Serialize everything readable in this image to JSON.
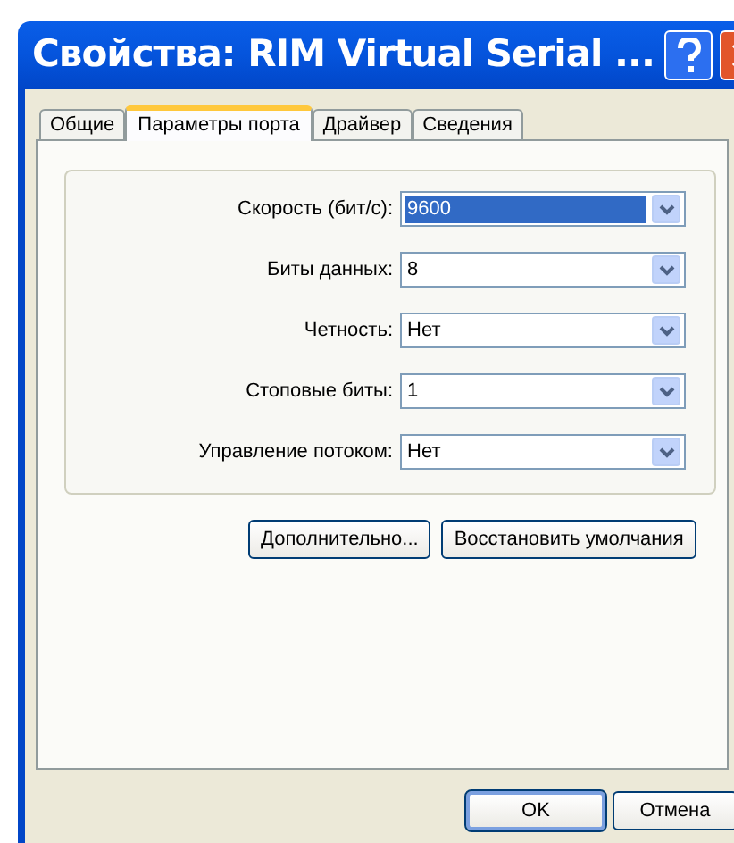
{
  "window": {
    "title": "Свойства: RIM Virtual Serial ..."
  },
  "tabs": [
    {
      "label": "Общие",
      "selected": false
    },
    {
      "label": "Параметры порта",
      "selected": true
    },
    {
      "label": "Драйвер",
      "selected": false
    },
    {
      "label": "Сведения",
      "selected": false
    }
  ],
  "settings": [
    {
      "label": "Скорость (бит/с):",
      "value": "9600",
      "focused": true
    },
    {
      "label": "Биты данных:",
      "value": "8",
      "focused": false
    },
    {
      "label": "Четность:",
      "value": "Нет",
      "focused": false
    },
    {
      "label": "Стоповые биты:",
      "value": "1",
      "focused": false
    },
    {
      "label": "Управление потоком:",
      "value": "Нет",
      "focused": false
    }
  ],
  "panel_buttons": [
    "Дополнительно...",
    "Восстановить умолчания"
  ],
  "dialog_buttons": [
    "OK",
    "Отмена"
  ]
}
